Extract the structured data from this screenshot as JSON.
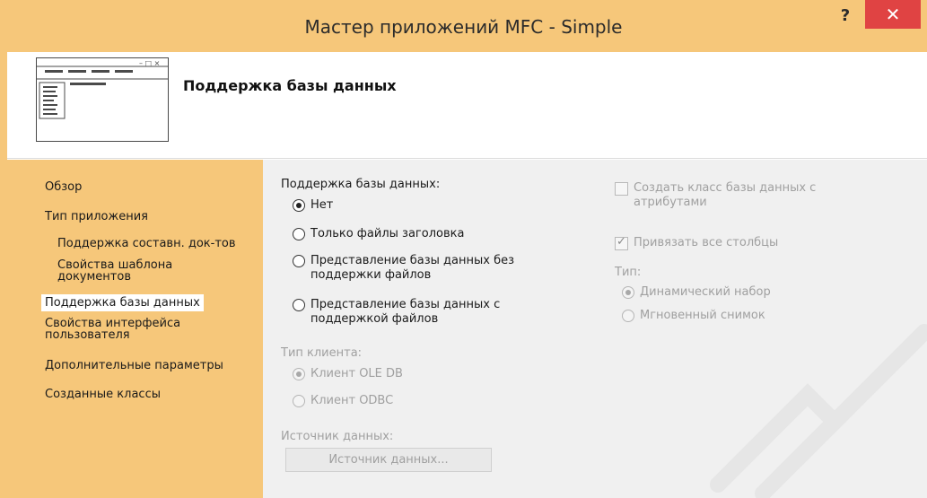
{
  "window": {
    "title": "Мастер приложений MFC - Simple",
    "help_label": "?",
    "close_label": "✕"
  },
  "header": {
    "title": "Поддержка базы данных"
  },
  "nav": {
    "items": [
      {
        "label": "Обзор"
      },
      {
        "label": "Тип приложения"
      },
      {
        "label": "Поддержка составн. док-тов"
      },
      {
        "label": "Свойства шаблона\nдокументов"
      },
      {
        "label": "Поддержка базы данных"
      },
      {
        "label": "Свойства интерфейса\nпользователя"
      },
      {
        "label": "Дополнительные параметры"
      },
      {
        "label": "Созданные классы"
      }
    ],
    "active_index": 4
  },
  "db_support": {
    "group_label": "Поддержка базы данных:",
    "options": [
      {
        "label": "Нет",
        "checked": true
      },
      {
        "label": "Только файлы заголовка",
        "checked": false
      },
      {
        "label": "Представление базы данных без\nподдержки файлов",
        "checked": false
      },
      {
        "label": "Представление базы данных с\nподдержкой файлов",
        "checked": false
      }
    ]
  },
  "client_type": {
    "group_label": "Тип клиента:",
    "options": [
      {
        "label": "Клиент OLE DB",
        "checked": true
      },
      {
        "label": "Клиент ODBC",
        "checked": false
      }
    ]
  },
  "data_source": {
    "group_label": "Источник данных:",
    "button_label": "Источник данных..."
  },
  "right_options": {
    "create_class_label": "Создать класс базы данных с\nатрибутами",
    "create_class_checked": false,
    "bind_all_label": "Привязать все столбцы",
    "bind_all_checked": true,
    "type_label": "Тип:",
    "type_options": [
      {
        "label": "Динамический набор",
        "checked": true
      },
      {
        "label": "Мгновенный снимок",
        "checked": false
      }
    ]
  },
  "colors": {
    "frame": "#f6c77a",
    "close_button": "#e04343",
    "panel": "#f0f0f0"
  }
}
